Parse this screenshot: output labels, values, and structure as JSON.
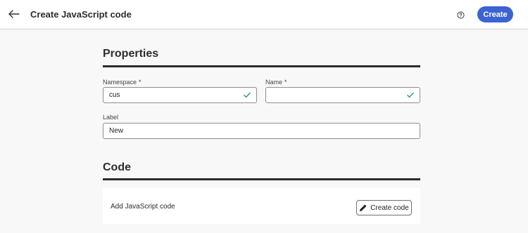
{
  "header": {
    "title": "Create JavaScript code",
    "back_icon": "arrow-left-icon",
    "help_icon": "help-circle-icon",
    "create_label": "Create",
    "accent_color": "#3b63d4"
  },
  "properties": {
    "title": "Properties",
    "namespace": {
      "label": "Namespace",
      "required_mark": "*",
      "value": "cus",
      "valid": true
    },
    "name": {
      "label": "Name",
      "required_mark": "*",
      "value": "",
      "valid": true
    },
    "label_field": {
      "label": "Label",
      "value": "New"
    }
  },
  "code": {
    "title": "Code",
    "panel_label": "Add JavaScript code",
    "create_code_label": "Create code",
    "create_code_icon": "pencil-icon"
  },
  "status_colors": {
    "valid": "#2d9d78"
  }
}
